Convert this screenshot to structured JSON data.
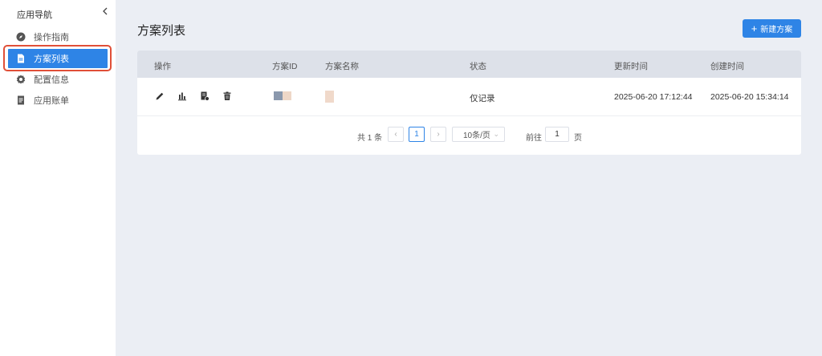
{
  "sidebar": {
    "title": "应用导航",
    "items": [
      {
        "label": "操作指南",
        "icon": "compass-icon"
      },
      {
        "label": "方案列表",
        "icon": "document-icon"
      },
      {
        "label": "配置信息",
        "icon": "gear-icon"
      },
      {
        "label": "应用账单",
        "icon": "bill-icon"
      }
    ],
    "active_index": 1
  },
  "main": {
    "title": "方案列表",
    "new_button_label": "新建方案"
  },
  "table": {
    "headers": {
      "ops": "操作",
      "id": "方案ID",
      "name": "方案名称",
      "status": "状态",
      "updated": "更新时间",
      "created": "创建时间"
    },
    "rows": [
      {
        "ops": [
          "edit-icon",
          "chart-icon",
          "report-icon",
          "delete-icon"
        ],
        "status": "仅记录",
        "updated": "2025-06-20 17:12:44",
        "created": "2025-06-20 15:34:14"
      }
    ]
  },
  "pagination": {
    "total": "共 1 条",
    "current_page": "1",
    "page_size": "10条/页",
    "goto_label": "前往",
    "goto_value": "1",
    "page_suffix": "页"
  },
  "colors": {
    "accent": "#2e84e6",
    "highlight": "#e04f38",
    "background": "#ebeef4",
    "table_header": "#dde1e9"
  }
}
